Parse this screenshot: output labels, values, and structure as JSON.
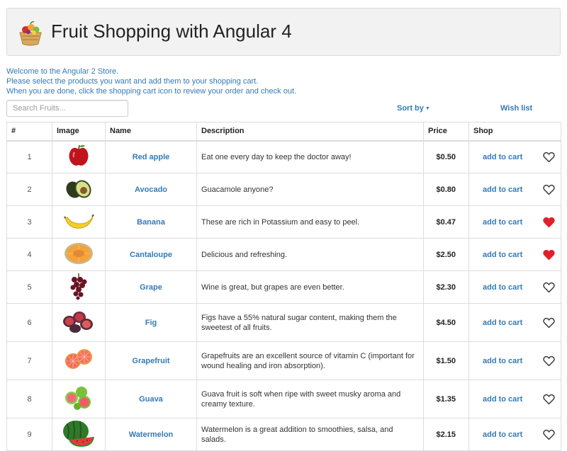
{
  "header": {
    "title": "Fruit Shopping with Angular 4",
    "logo_icon": "fruit-basket-icon"
  },
  "welcome": {
    "line1": "Welcome to the Angular 2 Store.",
    "line2": "Please select the products you want and add them to your shopping cart.",
    "line3": "When you are done, click the shopping cart icon to review your order and check out."
  },
  "search": {
    "placeholder": "Search Fruits...",
    "value": ""
  },
  "toolbar": {
    "sort_label": "Sort by",
    "wishlist_label": "Wish list"
  },
  "columns": {
    "num": "#",
    "image": "Image",
    "name": "Name",
    "description": "Description",
    "price": "Price",
    "shop": "Shop"
  },
  "add_label": "add to cart",
  "colors": {
    "link": "#337ab7",
    "heart_filled": "#e0202a",
    "heart_outline": "#333333"
  },
  "products": [
    {
      "num": "1",
      "name": "Red apple",
      "description": "Eat one every day to keep the doctor away!",
      "price": "$0.50",
      "wished": false,
      "icon": "apple-icon"
    },
    {
      "num": "2",
      "name": "Avocado",
      "description": "Guacamole anyone?",
      "price": "$0.80",
      "wished": false,
      "icon": "avocado-icon"
    },
    {
      "num": "3",
      "name": "Banana",
      "description": "These are rich in Potassium and easy to peel.",
      "price": "$0.47",
      "wished": true,
      "icon": "banana-icon"
    },
    {
      "num": "4",
      "name": "Cantaloupe",
      "description": "Delicious and refreshing.",
      "price": "$2.50",
      "wished": true,
      "icon": "cantaloupe-icon"
    },
    {
      "num": "5",
      "name": "Grape",
      "description": "Wine is great, but grapes are even better.",
      "price": "$2.30",
      "wished": false,
      "icon": "grape-icon"
    },
    {
      "num": "6",
      "name": "Fig",
      "description": "Figs have a 55% natural sugar content, making them the sweetest of all fruits.",
      "price": "$4.50",
      "wished": false,
      "icon": "fig-icon"
    },
    {
      "num": "7",
      "name": "Grapefruit",
      "description": "Grapefruits are an excellent source of vitamin C (important for wound healing and iron absorption).",
      "price": "$1.50",
      "wished": false,
      "icon": "grapefruit-icon"
    },
    {
      "num": "8",
      "name": "Guava",
      "description": "Guava fruit is soft when ripe with sweet musky aroma and creamy texture.",
      "price": "$1.35",
      "wished": false,
      "icon": "guava-icon"
    },
    {
      "num": "9",
      "name": "Watermelon",
      "description": "Watermelon is a great addition to smoothies, salsa, and salads.",
      "price": "$2.15",
      "wished": false,
      "icon": "watermelon-icon"
    }
  ]
}
